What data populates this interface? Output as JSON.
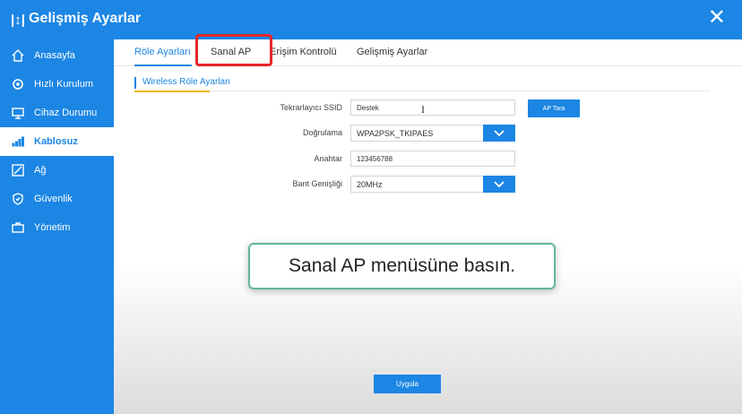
{
  "window": {
    "title": "Gelişmiş Ayarlar"
  },
  "sidebar": {
    "items": [
      {
        "label": "Anasayfa",
        "icon": "home-icon"
      },
      {
        "label": "Hızlı Kurulum",
        "icon": "gear-icon"
      },
      {
        "label": "Cihaz Durumu",
        "icon": "monitor-icon"
      },
      {
        "label": "Kablosuz",
        "icon": "signal-bars-icon",
        "active": true
      },
      {
        "label": "Ağ",
        "icon": "network-icon"
      },
      {
        "label": "Güvenlik",
        "icon": "shield-icon"
      },
      {
        "label": "Yönetim",
        "icon": "toolbox-icon"
      }
    ]
  },
  "tabs": [
    {
      "label": "Röle Ayarları",
      "active": true
    },
    {
      "label": "Sanal AP",
      "highlighted": true
    },
    {
      "label": "Erişim Kontrolü"
    },
    {
      "label": "Gelişmiş Ayarlar"
    }
  ],
  "section": {
    "title": "Wireless Röle Ayarları"
  },
  "form": {
    "ssid": {
      "label": "Tekrarlayıcı SSID",
      "value": "Destek"
    },
    "auth": {
      "label": "Doğrulama",
      "value": "WPA2PSK_TKIPAES"
    },
    "key": {
      "label": "Anahtar",
      "value": "123456788"
    },
    "bandwidth": {
      "label": "Bant Genişliği",
      "value": "20MHz"
    },
    "scan_button": "AP Tara"
  },
  "apply_button": "Uygula",
  "callout": {
    "text": "Sanal AP menüsüne basın."
  },
  "colors": {
    "accent": "#1c86e4",
    "highlight": "#e8262a",
    "callout_border": "#63b79a",
    "section_underline": "#f4b400"
  }
}
